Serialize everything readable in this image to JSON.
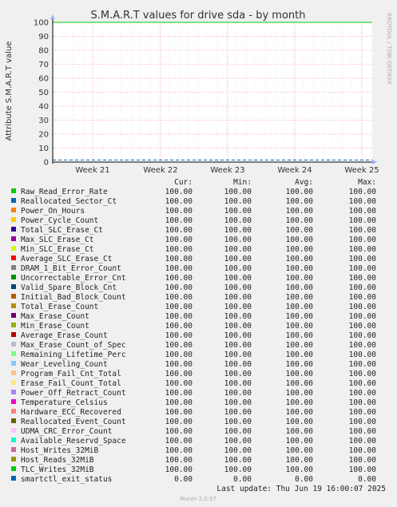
{
  "chart_data": {
    "type": "line",
    "title": "S.M.A.R.T values for drive sda - by month",
    "ylabel": "Attribute S.M.A.R.T value",
    "ylim": [
      0,
      100
    ],
    "yticks": [
      0,
      10,
      20,
      30,
      40,
      50,
      60,
      70,
      80,
      90,
      100
    ],
    "x_tick_labels": [
      "Week 21",
      "Week 22",
      "Week 23",
      "Week 24",
      "Week 25"
    ],
    "grid": true,
    "columns": [
      "Cur:",
      "Min:",
      "Avg:",
      "Max:"
    ],
    "series": [
      {
        "name": "Raw_Read_Error_Rate",
        "color": "#00cc00",
        "stats": [
          "100.00",
          "100.00",
          "100.00",
          "100.00"
        ]
      },
      {
        "name": "Reallocated_Sector_Ct",
        "color": "#0066b3",
        "stats": [
          "100.00",
          "100.00",
          "100.00",
          "100.00"
        ]
      },
      {
        "name": "Power_On_Hours",
        "color": "#ff8000",
        "stats": [
          "100.00",
          "100.00",
          "100.00",
          "100.00"
        ]
      },
      {
        "name": "Power_Cycle_Count",
        "color": "#ffcc00",
        "stats": [
          "100.00",
          "100.00",
          "100.00",
          "100.00"
        ]
      },
      {
        "name": "Total_SLC_Erase_Ct",
        "color": "#330099",
        "stats": [
          "100.00",
          "100.00",
          "100.00",
          "100.00"
        ]
      },
      {
        "name": "Max_SLC_Erase_Ct",
        "color": "#990099",
        "stats": [
          "100.00",
          "100.00",
          "100.00",
          "100.00"
        ]
      },
      {
        "name": "Min_SLC_Erase_Ct",
        "color": "#ccff00",
        "stats": [
          "100.00",
          "100.00",
          "100.00",
          "100.00"
        ]
      },
      {
        "name": "Average_SLC_Erase_Ct",
        "color": "#ff0000",
        "stats": [
          "100.00",
          "100.00",
          "100.00",
          "100.00"
        ]
      },
      {
        "name": "DRAM_1_Bit_Error_Count",
        "color": "#808080",
        "stats": [
          "100.00",
          "100.00",
          "100.00",
          "100.00"
        ]
      },
      {
        "name": "Uncorrectable_Error_Cnt",
        "color": "#008f00",
        "stats": [
          "100.00",
          "100.00",
          "100.00",
          "100.00"
        ]
      },
      {
        "name": "Valid_Spare_Block_Cnt",
        "color": "#00487d",
        "stats": [
          "100.00",
          "100.00",
          "100.00",
          "100.00"
        ]
      },
      {
        "name": "Initial_Bad_Block_Count",
        "color": "#b35a00",
        "stats": [
          "100.00",
          "100.00",
          "100.00",
          "100.00"
        ]
      },
      {
        "name": "Total_Erase_Count",
        "color": "#b38f00",
        "stats": [
          "100.00",
          "100.00",
          "100.00",
          "100.00"
        ]
      },
      {
        "name": "Max_Erase_Count",
        "color": "#6b006b",
        "stats": [
          "100.00",
          "100.00",
          "100.00",
          "100.00"
        ]
      },
      {
        "name": "Min_Erase_Count",
        "color": "#8fb300",
        "stats": [
          "100.00",
          "100.00",
          "100.00",
          "100.00"
        ]
      },
      {
        "name": "Average_Erase_Count",
        "color": "#b30000",
        "stats": [
          "100.00",
          "100.00",
          "100.00",
          "100.00"
        ]
      },
      {
        "name": "Max_Erase_Count_of_Spec",
        "color": "#bebebe",
        "stats": [
          "100.00",
          "100.00",
          "100.00",
          "100.00"
        ]
      },
      {
        "name": "Remaining_Lifetime_Perc",
        "color": "#80ff80",
        "stats": [
          "100.00",
          "100.00",
          "100.00",
          "100.00"
        ]
      },
      {
        "name": "Wear_Leveling_Count",
        "color": "#80c9ff",
        "stats": [
          "100.00",
          "100.00",
          "100.00",
          "100.00"
        ]
      },
      {
        "name": "Program_Fail_Cnt_Total",
        "color": "#ffc080",
        "stats": [
          "100.00",
          "100.00",
          "100.00",
          "100.00"
        ]
      },
      {
        "name": "Erase_Fail_Count_Total",
        "color": "#ffe680",
        "stats": [
          "100.00",
          "100.00",
          "100.00",
          "100.00"
        ]
      },
      {
        "name": "Power_Off_Retract_Count",
        "color": "#aa80ff",
        "stats": [
          "100.00",
          "100.00",
          "100.00",
          "100.00"
        ]
      },
      {
        "name": "Temperature_Celsius",
        "color": "#ee00cc",
        "stats": [
          "100.00",
          "100.00",
          "100.00",
          "100.00"
        ]
      },
      {
        "name": "Hardware_ECC_Recovered",
        "color": "#ff8080",
        "stats": [
          "100.00",
          "100.00",
          "100.00",
          "100.00"
        ]
      },
      {
        "name": "Reallocated_Event_Count",
        "color": "#666600",
        "stats": [
          "100.00",
          "100.00",
          "100.00",
          "100.00"
        ]
      },
      {
        "name": "UDMA_CRC_Error_Count",
        "color": "#ffbfff",
        "stats": [
          "100.00",
          "100.00",
          "100.00",
          "100.00"
        ]
      },
      {
        "name": "Available_Reservd_Space",
        "color": "#00ffcc",
        "stats": [
          "100.00",
          "100.00",
          "100.00",
          "100.00"
        ]
      },
      {
        "name": "Host_Writes_32MiB",
        "color": "#cc6699",
        "stats": [
          "100.00",
          "100.00",
          "100.00",
          "100.00"
        ]
      },
      {
        "name": "Host_Reads_32MiB",
        "color": "#999900",
        "stats": [
          "100.00",
          "100.00",
          "100.00",
          "100.00"
        ]
      },
      {
        "name": "TLC_Writes_32MiB",
        "color": "#00cc00",
        "stats": [
          "100.00",
          "100.00",
          "100.00",
          "100.00"
        ]
      },
      {
        "name": "smartctl_exit_status",
        "color": "#0066b3",
        "stats": [
          "0.00",
          "0.00",
          "0.00",
          "0.00"
        ],
        "plotted_value": 0
      },
      {
        "name": "",
        "color": "#0066b3",
        "plotted_value": 1.5
      }
    ]
  },
  "last_update": "Last update: Thu Jun 19 16:00:07 2025",
  "side_label": "RRDTOOL / TOBI OETIKER",
  "footer": "Munin 2.0.57"
}
